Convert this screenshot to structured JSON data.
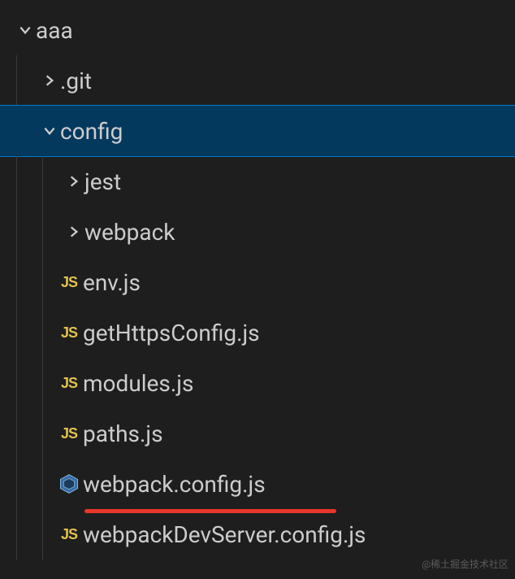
{
  "root": {
    "label": "aaa"
  },
  "git": {
    "label": ".git"
  },
  "config": {
    "label": "config"
  },
  "jest": {
    "label": "jest"
  },
  "webpack_dir": {
    "label": "webpack"
  },
  "files": {
    "env": "env.js",
    "getHttpsConfig": "getHttpsConfig.js",
    "modules": "modules.js",
    "paths": "paths.js",
    "webpackConfig": "webpack.config.js",
    "webpackDevServer": "webpackDevServer.config.js"
  },
  "watermark": "@稀土掘金技术社区"
}
